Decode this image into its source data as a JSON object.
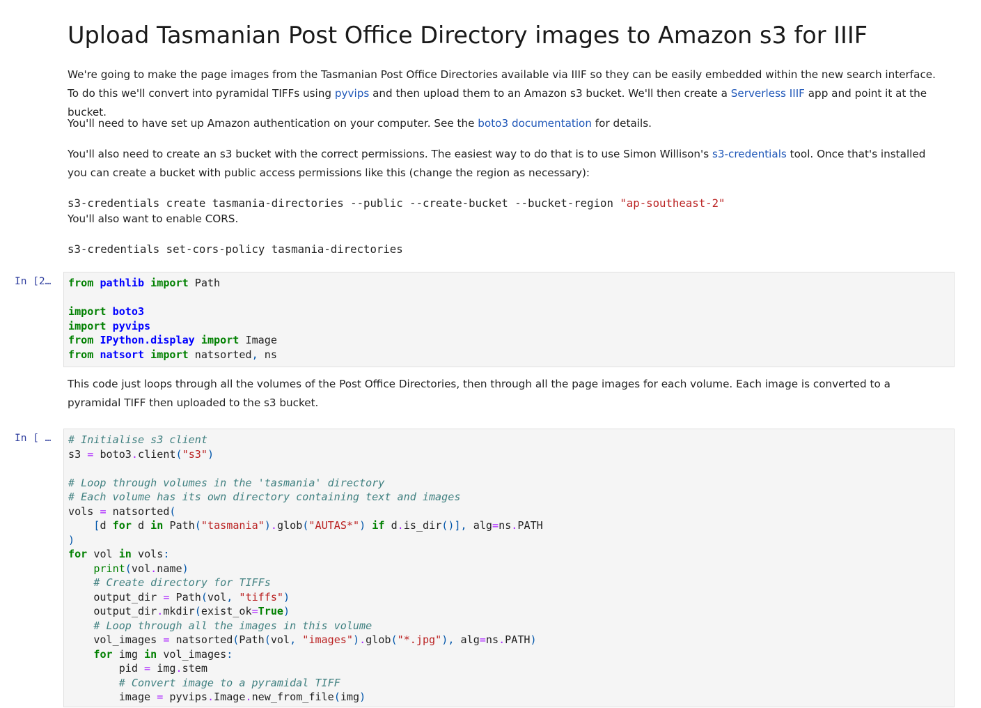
{
  "title": "Upload Tasmanian Post Office Directory images to Amazon s3 for IIIF",
  "intro": {
    "t1": "We're going to make the page images from the Tasmanian Post Office Directories available via IIIF so they can be easily embedded within the new search interface. To do this we'll convert into pyramidal TIFFs using ",
    "link1": "pyvips",
    "t2": " and then upload them to an Amazon s3 bucket. We'll then create a ",
    "link2": "Serverless IIIF",
    "t3": " app and point it at the bucket."
  },
  "auth": {
    "t1": "You'll need to have set up Amazon authentication on your computer. See the ",
    "link": "boto3 documentation",
    "t2": " for details."
  },
  "bucket": {
    "t1": "You'll also need to create an s3 bucket with the correct permissions. The easiest way to do that is to use Simon Willison's ",
    "link": "s3-credentials",
    "t2": " tool. Once that's installed you can create a bucket with public access permissions like this (change the region as necessary):"
  },
  "cmd1": {
    "text": "s3-credentials create tasmania-directories --public --create-bucket --bucket-region ",
    "str": "\"ap-southeast-2\""
  },
  "cors_text": "You'll also want to enable CORS.",
  "cmd2": "s3-credentials set-cors-policy tasmania-directories",
  "cell1": {
    "prompt": "In [2…"
  },
  "loop_text": "This code just loops through all the volumes of the Post Office Directories, then through all the page images for each volume. Each image is converted to a pyramidal TIFF then uploaded to the s3 bucket.",
  "cell2": {
    "prompt": "In [ …"
  },
  "colors": {
    "keyword": "#008000",
    "module": "#0000ff",
    "comment": "#408080",
    "string": "#ba2121",
    "operator": "#aa22ff",
    "link": "#1f57b8",
    "prompt": "#303f9f"
  }
}
